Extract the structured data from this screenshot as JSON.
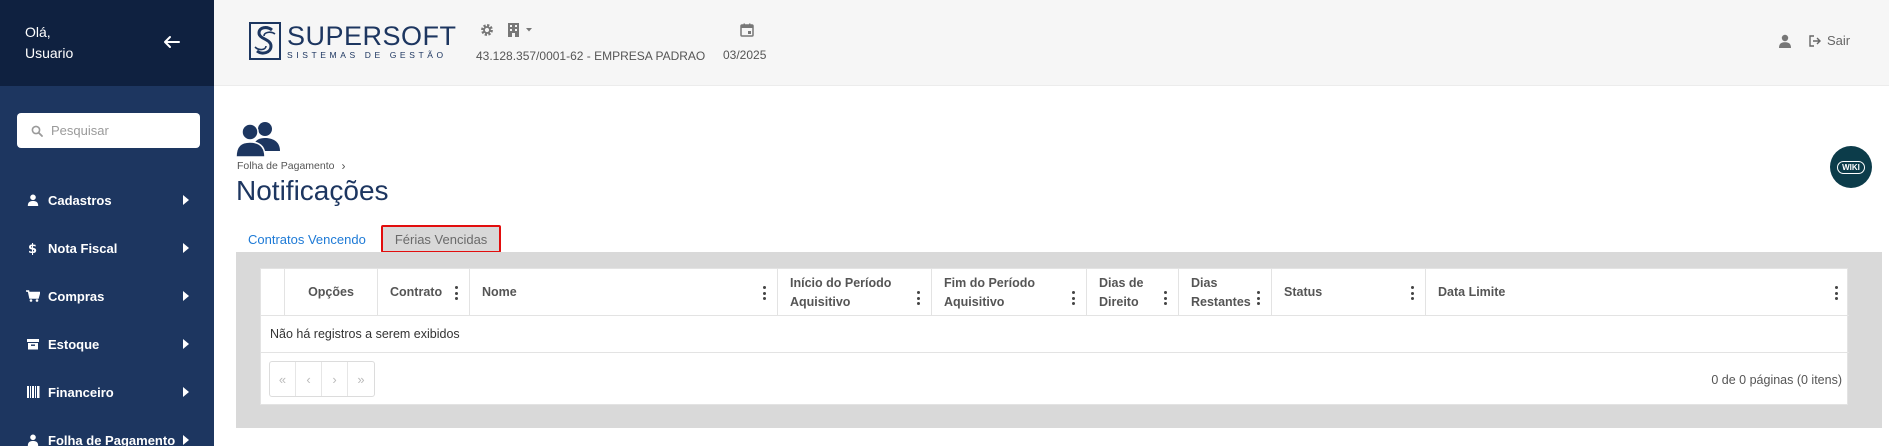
{
  "sidebar": {
    "greeting_line1": "Olá,",
    "greeting_line2": "Usuario",
    "search_placeholder": "Pesquisar",
    "items": [
      {
        "label": "Cadastros",
        "icon": "user-icon"
      },
      {
        "label": "Nota Fiscal",
        "icon": "dollar-icon"
      },
      {
        "label": "Compras",
        "icon": "cart-icon"
      },
      {
        "label": "Estoque",
        "icon": "box-icon"
      },
      {
        "label": "Financeiro",
        "icon": "barcode-icon"
      },
      {
        "label": "Folha de Pagamento",
        "icon": "user-icon"
      }
    ]
  },
  "header": {
    "logo_name": "SUPERSOFT",
    "logo_sub": "SISTEMAS DE GESTÃO",
    "company": "43.128.357/0001-62 - EMPRESA PADRAO",
    "period": "03/2025",
    "logout_label": "Sair"
  },
  "page": {
    "breadcrumb": "Folha de Pagamento",
    "title": "Notificações",
    "wiki_label": "WIKI",
    "tabs": [
      "Contratos Vencendo",
      "Férias Vencidas"
    ]
  },
  "grid": {
    "columns": [
      {
        "line1": "Opções",
        "line2": ""
      },
      {
        "line1": "Contrato",
        "line2": ""
      },
      {
        "line1": "Nome",
        "line2": ""
      },
      {
        "line1": "Início do Período",
        "line2": "Aquisitivo"
      },
      {
        "line1": "Fim do Período",
        "line2": "Aquisitivo"
      },
      {
        "line1": "Dias de",
        "line2": "Direito"
      },
      {
        "line1": "Dias",
        "line2": "Restantes"
      },
      {
        "line1": "Status",
        "line2": ""
      },
      {
        "line1": "Data Limite",
        "line2": ""
      }
    ],
    "empty_message": "Não há registros a serem exibidos",
    "pager": {
      "first": "«",
      "prev": "‹",
      "next": "›",
      "last": "»"
    },
    "page_info": "0 de 0 páginas (0 itens)"
  },
  "colors": {
    "sidebar_bg": "#1d3660",
    "sidebar_top_bg": "#0f2140",
    "title": "#1d3660",
    "active_tab": "#1e7ad6",
    "highlight_border": "#e20d0d"
  }
}
